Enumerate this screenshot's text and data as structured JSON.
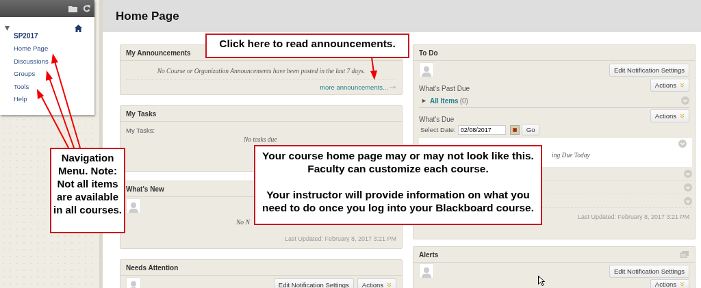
{
  "course_menu": {
    "course": "SP2017",
    "expanded": true,
    "items": [
      {
        "label": "Home Page"
      },
      {
        "label": "Discussions"
      },
      {
        "label": "Groups"
      },
      {
        "label": "Tools"
      },
      {
        "label": "Help"
      }
    ]
  },
  "page_title": "Home Page",
  "announcements": {
    "title": "My Announcements",
    "message": "No Course or Organization Announcements have been posted in the last 7 days.",
    "link": "more announcements..."
  },
  "tasks": {
    "title": "My Tasks",
    "label": "My Tasks:",
    "message": "No tasks due"
  },
  "whats_new": {
    "title": "What's New",
    "message": "No N",
    "updated": "Last Updated: February 8, 2017 3:21 PM"
  },
  "needs_attention": {
    "title": "Needs Attention",
    "settings_button": "Edit Notification Settings",
    "actions": "Actions"
  },
  "todo": {
    "title": "To Do",
    "settings_button": "Edit Notification Settings",
    "past_due": {
      "heading": "What's Past Due",
      "actions": "Actions",
      "item": {
        "label": "All Items",
        "count": "(0)",
        "expanded": false
      }
    },
    "due": {
      "heading": "What's Due",
      "actions": "Actions",
      "date_label": "Select Date:",
      "date_value": "02/08/2017",
      "go": "Go",
      "message": "ing Due Today"
    },
    "updated": "Last Updated: February 8, 2017 3:21 PM"
  },
  "alerts": {
    "title": "Alerts",
    "settings_button": "Edit Notification Settings",
    "actions": "Actions"
  },
  "callouts": [
    {
      "paragraphs": [
        "Click here to read announcements."
      ]
    },
    {
      "paragraphs": [
        "Navigation Menu. Note: Not all items are available in all courses."
      ]
    },
    {
      "paragraphs": [
        "Your course home page may or may not look like this. Faculty can customize each course.",
        "Your instructor will provide information on what you need to do once you log into your Blackboard course."
      ]
    }
  ]
}
